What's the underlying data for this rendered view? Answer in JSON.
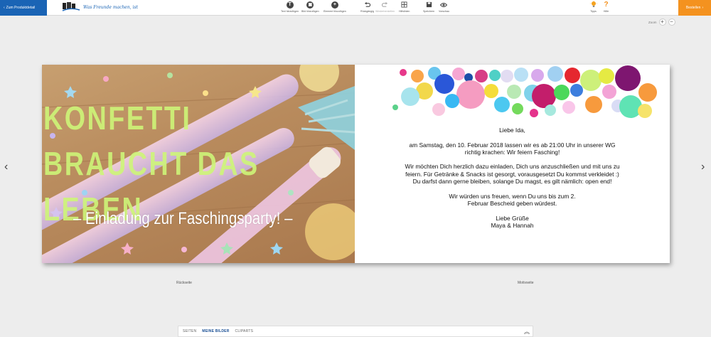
{
  "topbar": {
    "back_label": "Zum Produktdetail",
    "tagline": "Was Freunde machen, ist",
    "tools": [
      {
        "label": "Text hinzufügen"
      },
      {
        "label": "Bild hinzufügen"
      },
      {
        "label": "Element hinzufügen"
      },
      {
        "label": "Rückgängig"
      },
      {
        "label": "Wiederherstellen"
      },
      {
        "label": "Hilfslinien"
      },
      {
        "label": "Speichern"
      },
      {
        "label": "Vorschau"
      },
      {
        "label": "Tipps"
      },
      {
        "label": "Hilfe"
      }
    ],
    "next_label": "Bestellen"
  },
  "zoom": {
    "label": "Zoom",
    "plus": "+",
    "minus": "−"
  },
  "card": {
    "headline": "KONFETTI BRAUCHT DAS LEBEN",
    "subline": "– Einladung zur Faschingsparty! –",
    "letter": {
      "greeting": "Liebe Ida,",
      "p1": "am Samstag, den 10. Februar 2018 lassen wir es ab 21:00 Uhr in unserer WG richtig krachen: Wir feiern Fasching!",
      "p2": "Wir möchten Dich herzlich dazu einladen, Dich uns anzuschließen und mit uns zu feiern. Für Getränke & Snacks ist gesorgt, vorausgesetzt Du kommst verkleidet :) Du darfst dann gerne bleiben, solange Du magst, es gilt nämlich: open end!",
      "p3": "Wir würden uns freuen, wenn Du uns bis zum 2. Februar Bescheid geben würdest.",
      "closing": "Liebe Grüße",
      "signature": "Maya & Hannah"
    }
  },
  "labels": {
    "back_side": "Rückseite",
    "motif_side": "Motivseite"
  },
  "bottom_tabs": [
    "SEITEN",
    "MEINE BILDER",
    "CLIPARTS"
  ],
  "colors": {
    "accent_blue": "#1a64b5",
    "accent_orange": "#f4921f",
    "headline_green": "#cdf578"
  }
}
